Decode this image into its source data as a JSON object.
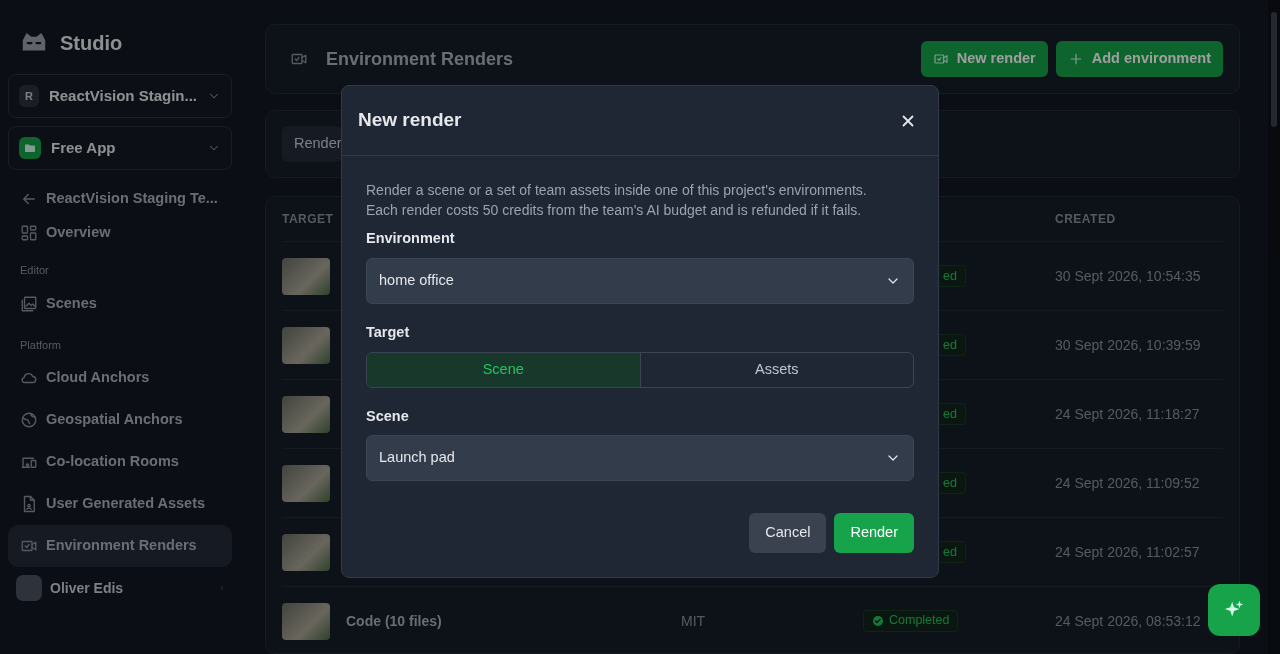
{
  "sidebar": {
    "brand": "Studio",
    "team": {
      "avatar": "R",
      "label": "ReactVision Stagin..."
    },
    "project": {
      "label": "Free App"
    },
    "back_link": "ReactVision Staging Te...",
    "sections": [
      {
        "items": [
          {
            "label": "Overview",
            "selected": false
          }
        ]
      },
      {
        "heading": "Editor",
        "items": [
          {
            "label": "Scenes",
            "selected": false
          }
        ]
      },
      {
        "heading": "Platform",
        "items": [
          {
            "label": "Cloud Anchors",
            "selected": false
          },
          {
            "label": "Geospatial Anchors",
            "selected": false
          },
          {
            "label": "Co-location Rooms",
            "selected": false
          },
          {
            "label": "User Generated Assets",
            "selected": false
          },
          {
            "label": "Environment Renders",
            "selected": true
          }
        ]
      }
    ],
    "user": {
      "name": "Oliver Edis"
    }
  },
  "page_header": {
    "title": "Environment Renders",
    "buttons": [
      {
        "label": "New render"
      },
      {
        "label": "Add environment"
      }
    ]
  },
  "filter": {
    "button": "Render"
  },
  "table": {
    "columns": [
      "TARGET",
      "CREATED"
    ],
    "rows": [
      {
        "kind": "covered",
        "status": "ed",
        "created": "30 Sept 2026, 10:54:35"
      },
      {
        "kind": "covered",
        "status": "ed",
        "created": "30 Sept 2026, 10:39:59"
      },
      {
        "kind": "covered",
        "status": "ed",
        "created": "24 Sept 2026, 11:18:27"
      },
      {
        "kind": "covered",
        "status": "ed",
        "created": "24 Sept 2026, 11:09:52"
      },
      {
        "kind": "covered",
        "status": "ed",
        "created": "24 Sept 2026, 11:02:57"
      },
      {
        "kind": "full",
        "name": "Code (10 files)",
        "license": "MIT",
        "status": "Completed",
        "created": "24 Sept 2026, 08:53:12"
      }
    ]
  },
  "modal": {
    "title": "New render",
    "description": "Render a scene or a set of team assets inside one of this project's environments. Each render costs 50 credits from the team's AI budget and is refunded if it fails.",
    "fields": [
      {
        "kind": "select",
        "label": "Environment",
        "value": "home office"
      },
      {
        "kind": "segmented",
        "label": "Target",
        "options": [
          {
            "label": "Scene",
            "selected": true
          },
          {
            "label": "Assets",
            "selected": false
          }
        ]
      },
      {
        "kind": "select",
        "label": "Scene",
        "value": "Launch pad"
      }
    ],
    "buttons": [
      {
        "label": "Cancel",
        "kind": "secondary"
      },
      {
        "label": "Render",
        "kind": "primary"
      }
    ]
  }
}
